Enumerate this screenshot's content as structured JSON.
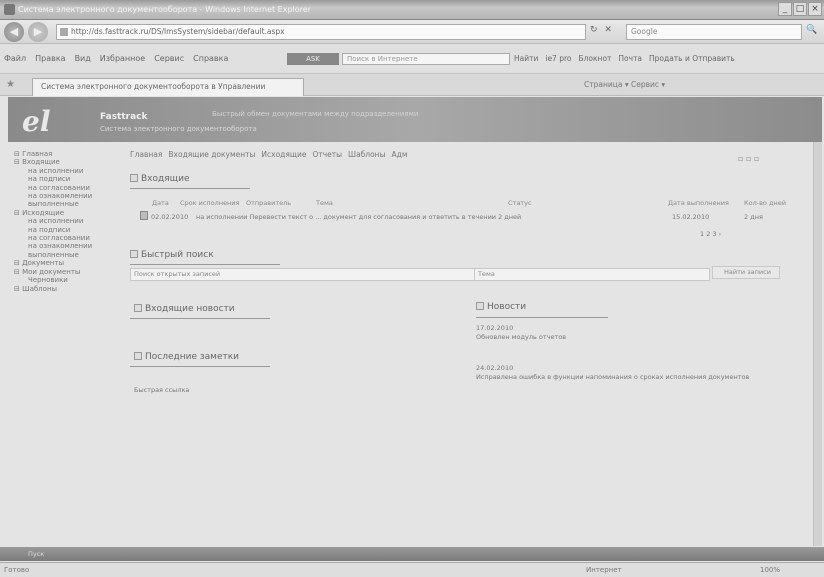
{
  "window": {
    "title": "Система электронного документооборота - Windows Internet Explorer",
    "min": "_",
    "max": "□",
    "close": "×"
  },
  "addressbar": {
    "back": "◀",
    "forward": "▶",
    "url": "http://ds.fasttrack.ru/DS/lmsSystem/sidebar/default.aspx",
    "reload_controls": "↻ ✕",
    "search_placeholder": "Google",
    "search_btn": "🔍"
  },
  "menubar": {
    "items": [
      "Файл",
      "Правка",
      "Вид",
      "Избранное",
      "Сервис",
      "Справка"
    ],
    "ask_label": "ASK",
    "ask_placeholder": "Поиск в Интернете",
    "toolbar_items": [
      "Найти",
      "ie7 pro",
      "Блокнот",
      "Почта",
      "Продать и Отправить"
    ]
  },
  "tabbar": {
    "tab_title": "Система электронного документооборота в Управлении",
    "tools": "Страница ▾  Сервис ▾"
  },
  "banner": {
    "logo": "el",
    "brand": "Fasttrack",
    "motto": "Система электронного документооборота",
    "tag": "Быстрый обмен документами между подразделениями"
  },
  "breadcrumbs": [
    "Главная",
    "Входящие документы",
    "Исходящие",
    "Отчеты",
    "Шаблоны",
    "Адм"
  ],
  "toprighticons": "▫ ▫ ▫",
  "sidebar": {
    "items": [
      {
        "level": 0,
        "label": "Главная"
      },
      {
        "level": 0,
        "label": "Входящие"
      },
      {
        "level": 1,
        "label": "на исполнении"
      },
      {
        "level": 1,
        "label": "на подписи"
      },
      {
        "level": 1,
        "label": "на согласовании"
      },
      {
        "level": 1,
        "label": "на ознакомлении"
      },
      {
        "level": 1,
        "label": "выполненные"
      },
      {
        "level": 0,
        "label": "Исходящие"
      },
      {
        "level": 1,
        "label": "на исполнении"
      },
      {
        "level": 1,
        "label": "на подписи"
      },
      {
        "level": 1,
        "label": "на согласовании"
      },
      {
        "level": 1,
        "label": "на ознакомлении"
      },
      {
        "level": 1,
        "label": "выполненные"
      },
      {
        "level": 0,
        "label": "Документы"
      },
      {
        "level": 0,
        "label": "Мои документы"
      },
      {
        "level": 1,
        "label": "Черновики"
      },
      {
        "level": 0,
        "label": "Шаблоны"
      }
    ]
  },
  "incoming": {
    "title": "Входящие",
    "columns": [
      "Дата",
      "Срок исполнения",
      "Отправитель",
      "Тема",
      "Статус",
      "Дата выполнения",
      "Кол-во дней"
    ],
    "row": {
      "date": "02.02.2010",
      "text": "на исполнении  Перевести текст о ... документ для согласования и ответить в течении 2 дней",
      "due": "15.02.2010",
      "days": "2 дня",
      "pager": "1  2  3    ›"
    }
  },
  "quick": {
    "title": "Быстрый поиск",
    "query_placeholder": "Поиск открытых записей",
    "topic_label": "Тема",
    "search_btn": "Найти записи"
  },
  "notes": {
    "title": "Входящие новости",
    "news_title": "Новости",
    "news": [
      {
        "date": "17.02.2010",
        "text": "Обновлен модуль отчетов"
      },
      {
        "date": "24.02.2010",
        "text": "Исправлена ошибка в функции напоминания о сроках исполнения документов"
      }
    ]
  },
  "lastnotes": {
    "title": "Последние заметки"
  },
  "quicklink": "Быстрая ссылка",
  "taskbar": {
    "label": "Пуск"
  },
  "status": {
    "left": "Готово",
    "zone": "Интернет",
    "zoom": "100%"
  }
}
